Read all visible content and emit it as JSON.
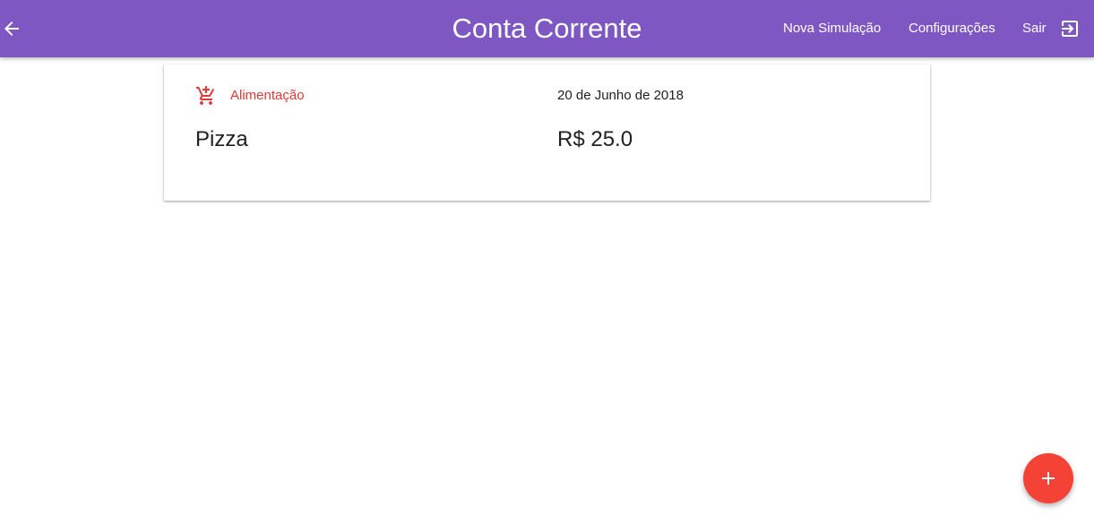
{
  "appbar": {
    "title": "Conta Corrente",
    "back_icon": "arrow-back-icon",
    "nav": {
      "nova_simulacao": "Nova Simulação",
      "configuracoes": "Configurações",
      "sair": "Sair",
      "sair_icon": "exit-to-app-icon"
    },
    "color": "#7e57c2"
  },
  "transaction": {
    "category_icon": "add-shopping-cart-icon",
    "category": "Alimentação",
    "category_color": "#e53935",
    "date": "20 de Junho de 2018",
    "description": "Pizza",
    "amount": "R$ 25.0"
  },
  "fab": {
    "icon": "plus-icon",
    "color": "#f44336"
  }
}
